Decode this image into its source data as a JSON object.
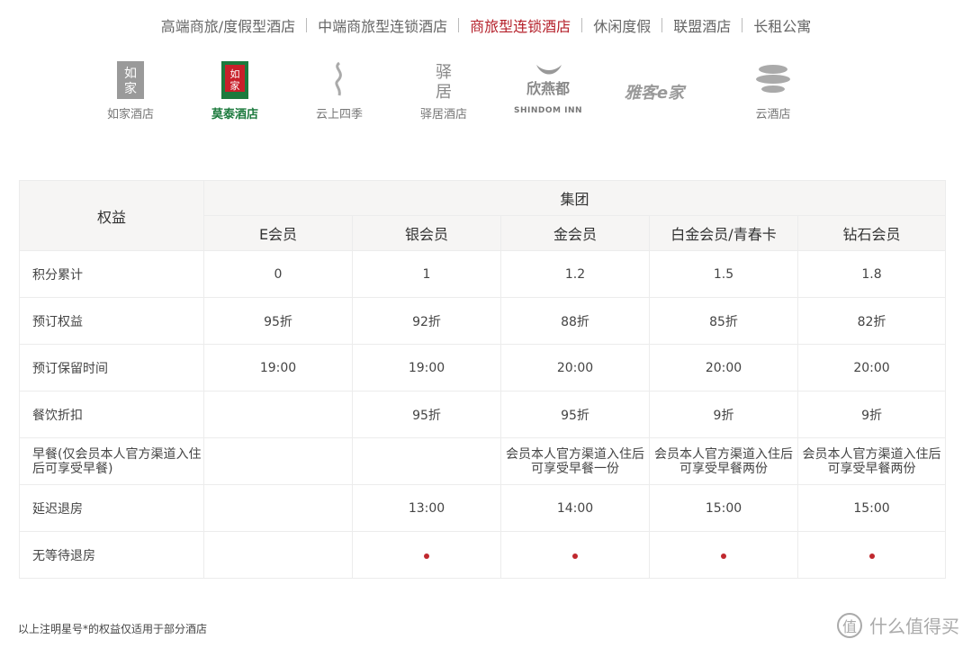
{
  "nav": {
    "items": [
      {
        "label": "高端商旅/度假型酒店",
        "active": false
      },
      {
        "label": "中端商旅型连锁酒店",
        "active": false
      },
      {
        "label": "商旅型连锁酒店",
        "active": true
      },
      {
        "label": "休闲度假",
        "active": false
      },
      {
        "label": "联盟酒店",
        "active": false
      },
      {
        "label": "长租公寓",
        "active": false
      }
    ]
  },
  "brands": [
    {
      "name": "如家酒店",
      "logo_text": "如\n家",
      "color": "#8a8a8a"
    },
    {
      "name": "莫泰酒店",
      "logo_text": "如\n家",
      "color": "#1c7a3d"
    },
    {
      "name": "云上四季",
      "logo_text": "云上四季",
      "color": "#9a9a9a"
    },
    {
      "name": "驿居酒店",
      "logo_text": "驿\n居",
      "color": "#8a8a8a"
    },
    {
      "name": "欣燕都",
      "logo_text": "SHINDOM INN",
      "color": "#8a8a8a"
    },
    {
      "name": "",
      "logo_text": "雅客e家",
      "color": "#8a8a8a"
    },
    {
      "name": "云酒店",
      "logo_text": "",
      "color": "#9a9a9a"
    }
  ],
  "table": {
    "header_label": "权益",
    "group_label": "集团",
    "tiers": [
      "E会员",
      "银会员",
      "金会员",
      "白金会员/青春卡",
      "钻石会员"
    ],
    "rows": [
      {
        "label": "积分累计",
        "cells": [
          "0",
          "1",
          "1.2",
          "1.5",
          "1.8"
        ]
      },
      {
        "label": "预订权益",
        "cells": [
          "95折",
          "92折",
          "88折",
          "85折",
          "82折"
        ]
      },
      {
        "label": "预订保留时间",
        "cells": [
          "19:00",
          "19:00",
          "20:00",
          "20:00",
          "20:00"
        ]
      },
      {
        "label": "餐饮折扣",
        "cells": [
          "",
          "95折",
          "95折",
          "9折",
          "9折"
        ]
      },
      {
        "label": "早餐(仅会员本人官方渠道入住后可享受早餐)",
        "cells": [
          "",
          "",
          "会员本人官方渠道入住后可享受早餐一份",
          "会员本人官方渠道入住后可享受早餐两份",
          "会员本人官方渠道入住后可享受早餐两份"
        ]
      },
      {
        "label": "延迟退房",
        "cells": [
          "",
          "13:00",
          "14:00",
          "15:00",
          "15:00"
        ]
      },
      {
        "label": "无等待退房",
        "cells": [
          "",
          "●",
          "●",
          "●",
          "●"
        ]
      }
    ]
  },
  "footnote": "以上注明星号*的权益仅适用于部分酒店",
  "watermark": {
    "icon_text": "值",
    "text": "什么值得买"
  },
  "colors": {
    "accent": "#b5212b",
    "header_bg": "#f6f5f4",
    "dot": "#c0282e"
  }
}
